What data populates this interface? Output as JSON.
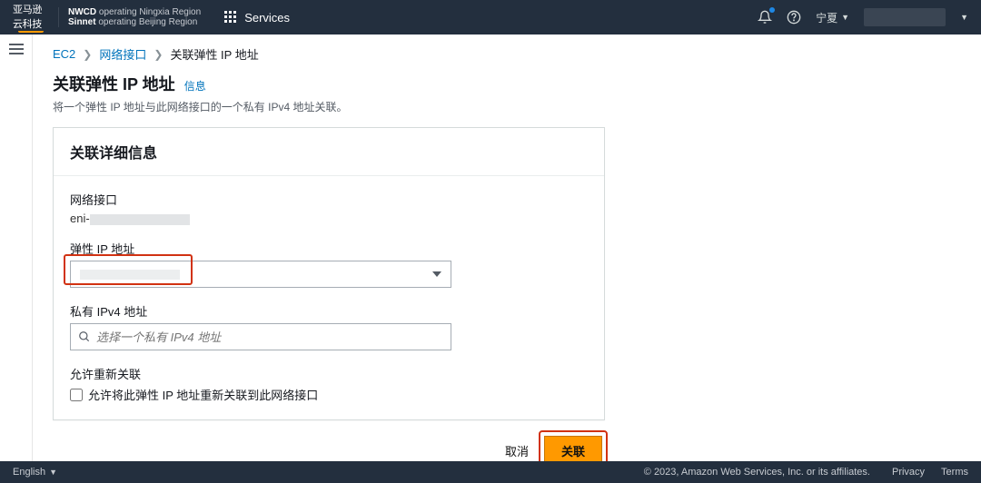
{
  "header": {
    "logo_text": "亚马逊云科技",
    "partner_line1_bold": "NWCD",
    "partner_line1_rest": " operating Ningxia Region",
    "partner_line2_bold": "Sinnet",
    "partner_line2_rest": " operating Beijing Region",
    "services_label": "Services",
    "region": "宁夏"
  },
  "breadcrumb": {
    "item1": "EC2",
    "item2": "网络接口",
    "item3": "关联弹性 IP 地址"
  },
  "page": {
    "title": "关联弹性 IP 地址",
    "info": "信息",
    "subtitle": "将一个弹性 IP 地址与此网络接口的一个私有 IPv4 地址关联。"
  },
  "panel": {
    "header": "关联详细信息",
    "eni_label": "网络接口",
    "eni_value_prefix": "eni-",
    "eip_label": "弹性 IP 地址",
    "private_label": "私有 IPv4 地址",
    "private_placeholder": "选择一个私有 IPv4 地址",
    "reassoc_label": "允许重新关联",
    "reassoc_checkbox": "允许将此弹性 IP 地址重新关联到此网络接口"
  },
  "buttons": {
    "cancel": "取消",
    "submit": "关联"
  },
  "footer": {
    "language": "English",
    "copyright": "© 2023, Amazon Web Services, Inc. or its affiliates.",
    "privacy": "Privacy",
    "terms": "Terms"
  }
}
